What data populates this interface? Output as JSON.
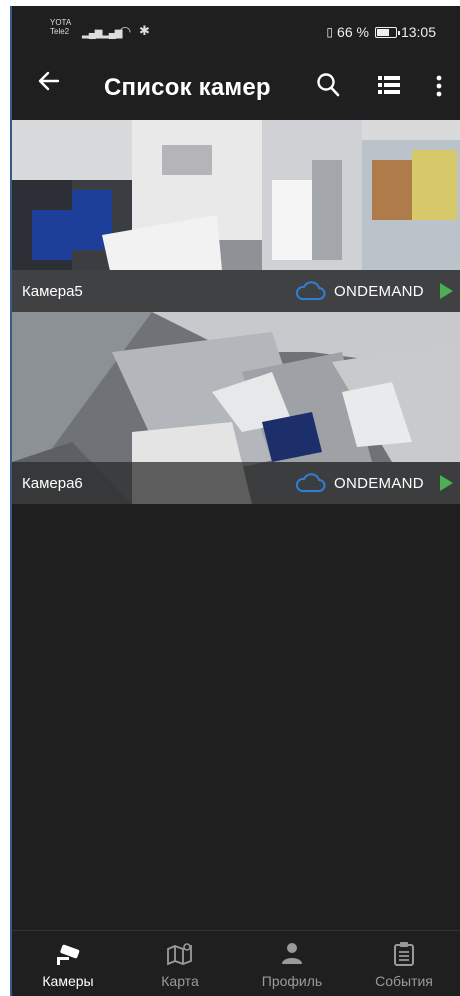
{
  "status": {
    "carrier1": "YOTA",
    "carrier2": "Tele2",
    "battery": "66 %",
    "battery_level": 0.66,
    "time": "13:05"
  },
  "appbar": {
    "title": "Список камер",
    "icons": [
      "back-arrow-icon",
      "search-icon",
      "list-view-icon",
      "more-vert-icon"
    ]
  },
  "cameras": [
    {
      "name": "Камера5",
      "mode": "ONDEMAND",
      "icons": [
        "cloud-icon",
        "play-icon"
      ]
    },
    {
      "name": "Камера6",
      "mode": "ONDEMAND",
      "icons": [
        "cloud-icon",
        "play-icon"
      ]
    }
  ],
  "colors": {
    "accent_cloud": "#2f7fd6",
    "play": "#4caf50",
    "background": "#1f1f1f"
  },
  "nav": {
    "items": [
      {
        "label": "Камеры",
        "icon": "cctv-camera-icon",
        "active": true
      },
      {
        "label": "Карта",
        "icon": "map-icon",
        "active": false
      },
      {
        "label": "Профиль",
        "icon": "person-icon",
        "active": false
      },
      {
        "label": "События",
        "icon": "clipboard-list-icon",
        "active": false
      }
    ]
  }
}
